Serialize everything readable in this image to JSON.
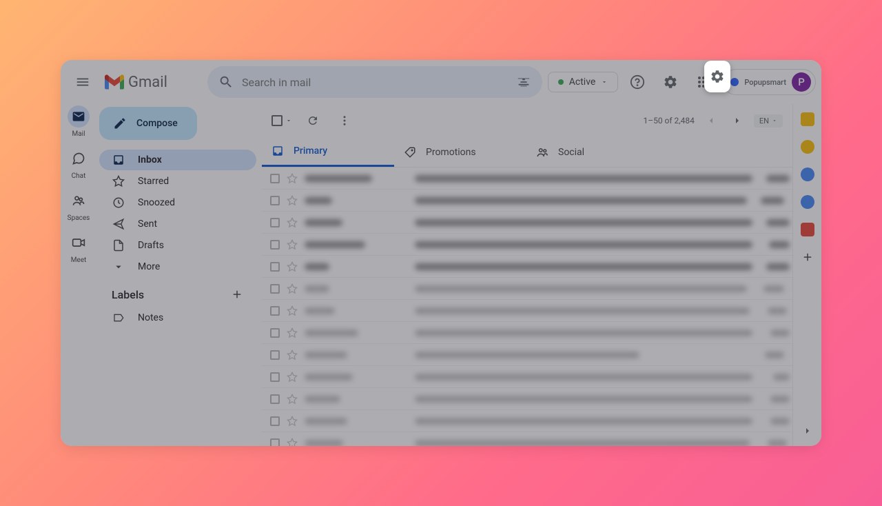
{
  "app": {
    "name": "Gmail",
    "search_placeholder": "Search in mail",
    "status": "Active",
    "profile_org": "Popupsmart",
    "profile_initial": "P"
  },
  "rail": {
    "mail": "Mail",
    "chat": "Chat",
    "spaces": "Spaces",
    "meet": "Meet"
  },
  "sidebar": {
    "compose": "Compose",
    "inbox": "Inbox",
    "starred": "Starred",
    "snoozed": "Snoozed",
    "sent": "Sent",
    "drafts": "Drafts",
    "more": "More",
    "labels_header": "Labels",
    "notes": "Notes"
  },
  "toolbar": {
    "page_info": "1–50 of 2,484",
    "lang": "EN"
  },
  "tabs": {
    "primary": "Primary",
    "promotions": "Promotions",
    "social": "Social"
  },
  "mail_rows": [
    {
      "sender_w": 98,
      "subj_w": 490,
      "date_w": 34,
      "bold": true
    },
    {
      "sender_w": 40,
      "subj_w": 482,
      "date_w": 34,
      "bold": true
    },
    {
      "sender_w": 55,
      "subj_w": 490,
      "date_w": 34,
      "bold": true
    },
    {
      "sender_w": 88,
      "subj_w": 490,
      "date_w": 30,
      "bold": true
    },
    {
      "sender_w": 36,
      "subj_w": 490,
      "date_w": 34,
      "bold": true
    },
    {
      "sender_w": 36,
      "subj_w": 482,
      "date_w": 30,
      "bold": false
    },
    {
      "sender_w": 44,
      "subj_w": 486,
      "date_w": 28,
      "bold": false
    },
    {
      "sender_w": 78,
      "subj_w": 490,
      "date_w": 28,
      "bold": false
    },
    {
      "sender_w": 62,
      "subj_w": 326,
      "date_w": 28,
      "bold": false
    },
    {
      "sender_w": 70,
      "subj_w": 490,
      "date_w": 24,
      "bold": false
    },
    {
      "sender_w": 52,
      "subj_w": 490,
      "date_w": 28,
      "bold": false
    },
    {
      "sender_w": 62,
      "subj_w": 490,
      "date_w": 28,
      "bold": false
    },
    {
      "sender_w": 56,
      "subj_w": 486,
      "date_w": 28,
      "bold": false
    },
    {
      "sender_w": 56,
      "subj_w": 490,
      "date_w": 28,
      "bold": false
    }
  ]
}
